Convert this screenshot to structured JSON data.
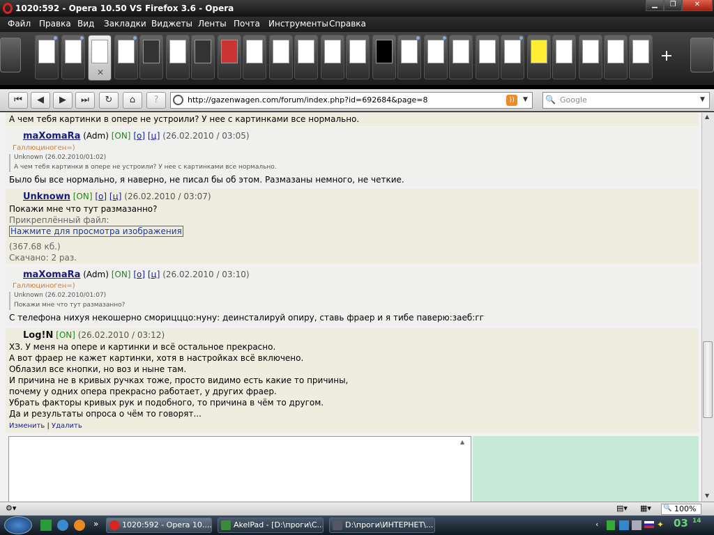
{
  "window": {
    "title": "1020:592 - Opera 10.50 VS Firefox 3.6 - Opera"
  },
  "menu": [
    "Файл",
    "Правка",
    "Вид",
    "Закладки",
    "Виджеты",
    "Ленты",
    "Почта",
    "Инструменты",
    "Справка"
  ],
  "address": {
    "url": "http://gazenwagen.com/forum/index.php?id=692684&page=8",
    "search_placeholder": "Google"
  },
  "posts": [
    {
      "kind": "text",
      "text": "А чем тебя картинки в опере не устроили? У нее с картинками все нормально."
    },
    {
      "kind": "post",
      "nick": "maXomaRa",
      "role": "(Adm)",
      "on": "[ON]",
      "o": "[о]",
      "c": "[ц]",
      "date": "(26.02.2010 / 03:05)",
      "status": "Галлюциноген=)",
      "quote_head": "Unknown (26.02.2010/01:02)",
      "quote_text": "А чем тебя картинки в опере не устроили? У нее с картинками все нормально.",
      "body": [
        "Было бы все нормально, я наверно, не писал бы об этом. Размазаны немного, не четкие."
      ]
    },
    {
      "kind": "post",
      "nick": "Unknown",
      "on": "[ON]",
      "o": "[о]",
      "c": "[ц]",
      "date": "(26.02.2010 / 03:07)",
      "body": [
        "Покажи мне что тут размазанно?"
      ],
      "attach_label": "Прикреплённый файл:",
      "attach_link": "Нажмите для просмотра изображения",
      "attach_size": "(367.68 кб.)",
      "attach_downloads": "Скачано: 2 раз."
    },
    {
      "kind": "post",
      "nick": "maXomaRa",
      "role": "(Adm)",
      "on": "[ON]",
      "o": "[о]",
      "c": "[ц]",
      "date": "(26.02.2010 / 03:10)",
      "status": "Галлюциноген=)",
      "quote_head": "Unknown (26.02.2010/01:07)",
      "quote_text": "Покажи мне что тут размазанно?",
      "body": [
        "С телефона нихуя некошерно сморицццо:нуну: деинсталируй опиру, ставь фраер и я тибе паверю:заеб:гг"
      ]
    },
    {
      "kind": "post",
      "nick": "Log!N",
      "on": "[ON]",
      "date": "(26.02.2010 / 03:12)",
      "body": [
        "ХЗ. У меня на опере и картинки и всё остальное прекрасно.",
        "А вот фраер не кажет картинки, хотя в настройках всё включено.",
        "Облазил все кнопки, но воз и ныне там.",
        "И причина не в кривых ручках тоже, просто видимо есть какие то причины,",
        "почему у одних опера прекрасно работает, у других фраер.",
        "Убрать факторы кривых рук и подобного, то причина в чём то другом.",
        "Да и результаты опроса о чём то говорят..."
      ],
      "edit": "Изменить",
      "sep": "|",
      "delete": "Удалить"
    }
  ],
  "statusbar": {
    "zoom": "100%"
  },
  "taskbar": {
    "items": [
      "1020:592 - Opera 10....",
      "AkelPad - [D:\\проги\\С...",
      "D:\\проги\\ИНТЕРНЕТ\\..."
    ],
    "clock_hour": "03",
    "clock_min": "14"
  }
}
